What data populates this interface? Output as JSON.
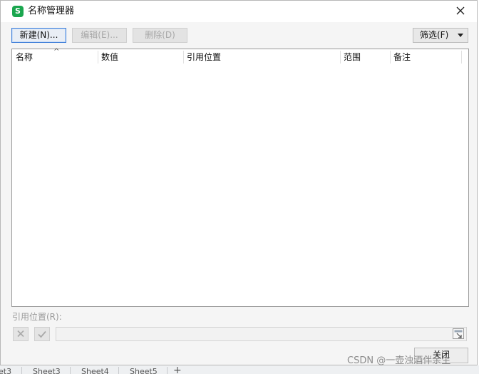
{
  "dialog": {
    "title": "名称管理器",
    "app_icon_letter": "S"
  },
  "toolbar": {
    "new_label": "新建(N)...",
    "edit_label": "编辑(E)...",
    "delete_label": "删除(D)",
    "filter_label": "筛选(F)"
  },
  "list": {
    "columns": [
      "名称",
      "数值",
      "引用位置",
      "范围",
      "备注"
    ],
    "sort_indicator": "^",
    "rows": []
  },
  "reference": {
    "label": "引用位置(R):",
    "value": ""
  },
  "footer": {
    "close_label": "关闭"
  },
  "background": {
    "sheet_tabs": [
      "et3",
      "Sheet3",
      "Sheet4",
      "Sheet5"
    ],
    "add_tab_symbol": "+"
  },
  "watermark": "CSDN @一壶浊酒伴余生",
  "colors": {
    "accent_border": "#3f7fd9",
    "icon_green": "#1aa64e"
  }
}
